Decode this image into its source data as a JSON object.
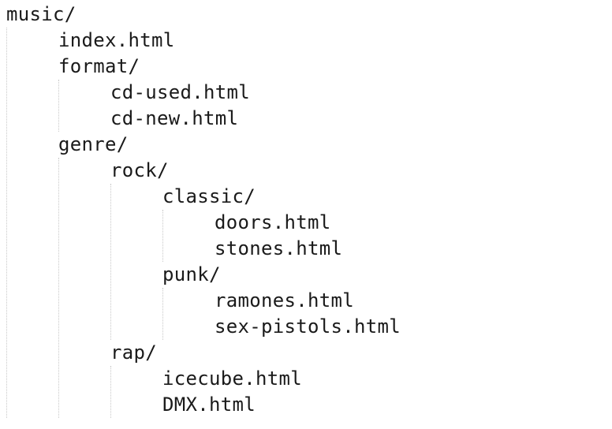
{
  "tree": [
    {
      "name": "music/",
      "depth": 0
    },
    {
      "name": "index.html",
      "depth": 1
    },
    {
      "name": "format/",
      "depth": 1
    },
    {
      "name": "cd-used.html",
      "depth": 2
    },
    {
      "name": "cd-new.html",
      "depth": 2
    },
    {
      "name": "genre/",
      "depth": 1
    },
    {
      "name": "rock/",
      "depth": 2
    },
    {
      "name": "classic/",
      "depth": 3
    },
    {
      "name": "doors.html",
      "depth": 4
    },
    {
      "name": "stones.html",
      "depth": 4
    },
    {
      "name": "punk/",
      "depth": 3
    },
    {
      "name": "ramones.html",
      "depth": 4
    },
    {
      "name": "sex-pistols.html",
      "depth": 4
    },
    {
      "name": "rap/",
      "depth": 2
    },
    {
      "name": "icecube.html",
      "depth": 3
    },
    {
      "name": "DMX.html",
      "depth": 3
    }
  ]
}
